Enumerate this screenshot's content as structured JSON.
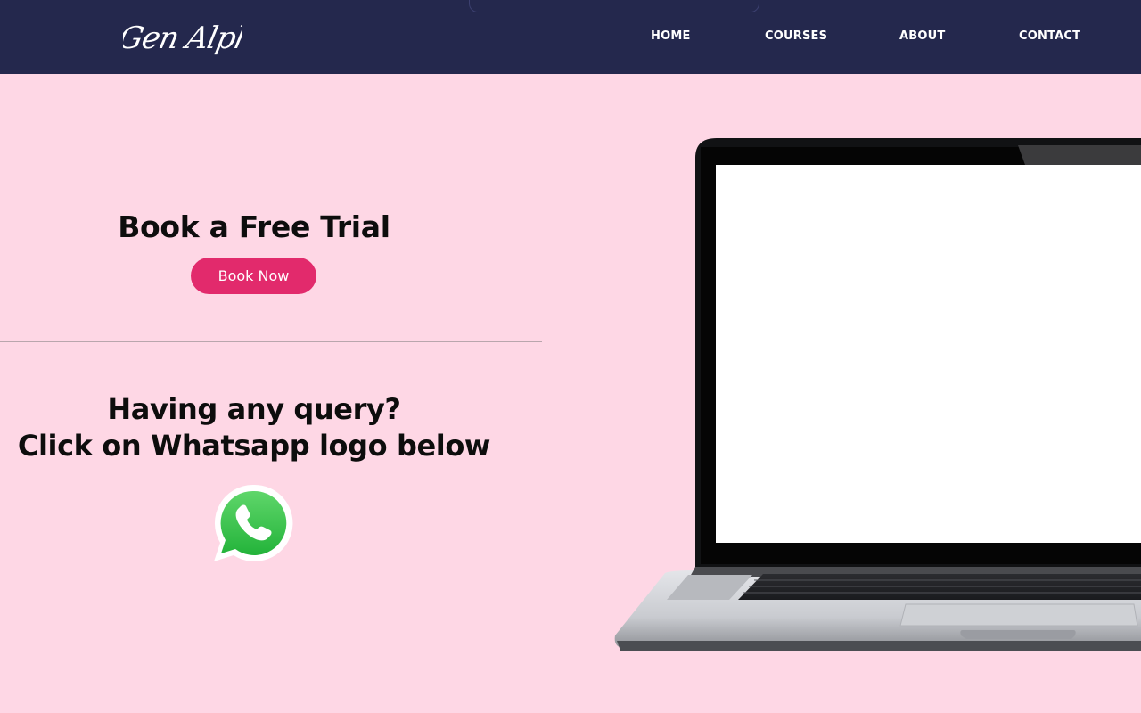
{
  "header": {
    "logo_text": "Gen Alpha",
    "nav": [
      {
        "label": "HOME"
      },
      {
        "label": "COURSES"
      },
      {
        "label": "ABOUT"
      },
      {
        "label": "CONTACT"
      }
    ]
  },
  "hero": {
    "trial_title": "Book a Free Trial",
    "book_button": "Book Now",
    "query_line1": "Having any query?",
    "query_line2": "Click on Whatsapp logo below",
    "whatsapp_icon": "whatsapp-icon"
  },
  "colors": {
    "header_bg": "#24284d",
    "page_bg": "#fed7e5",
    "button_bg": "#e22a6c",
    "whatsapp_green": "#29b43f"
  }
}
